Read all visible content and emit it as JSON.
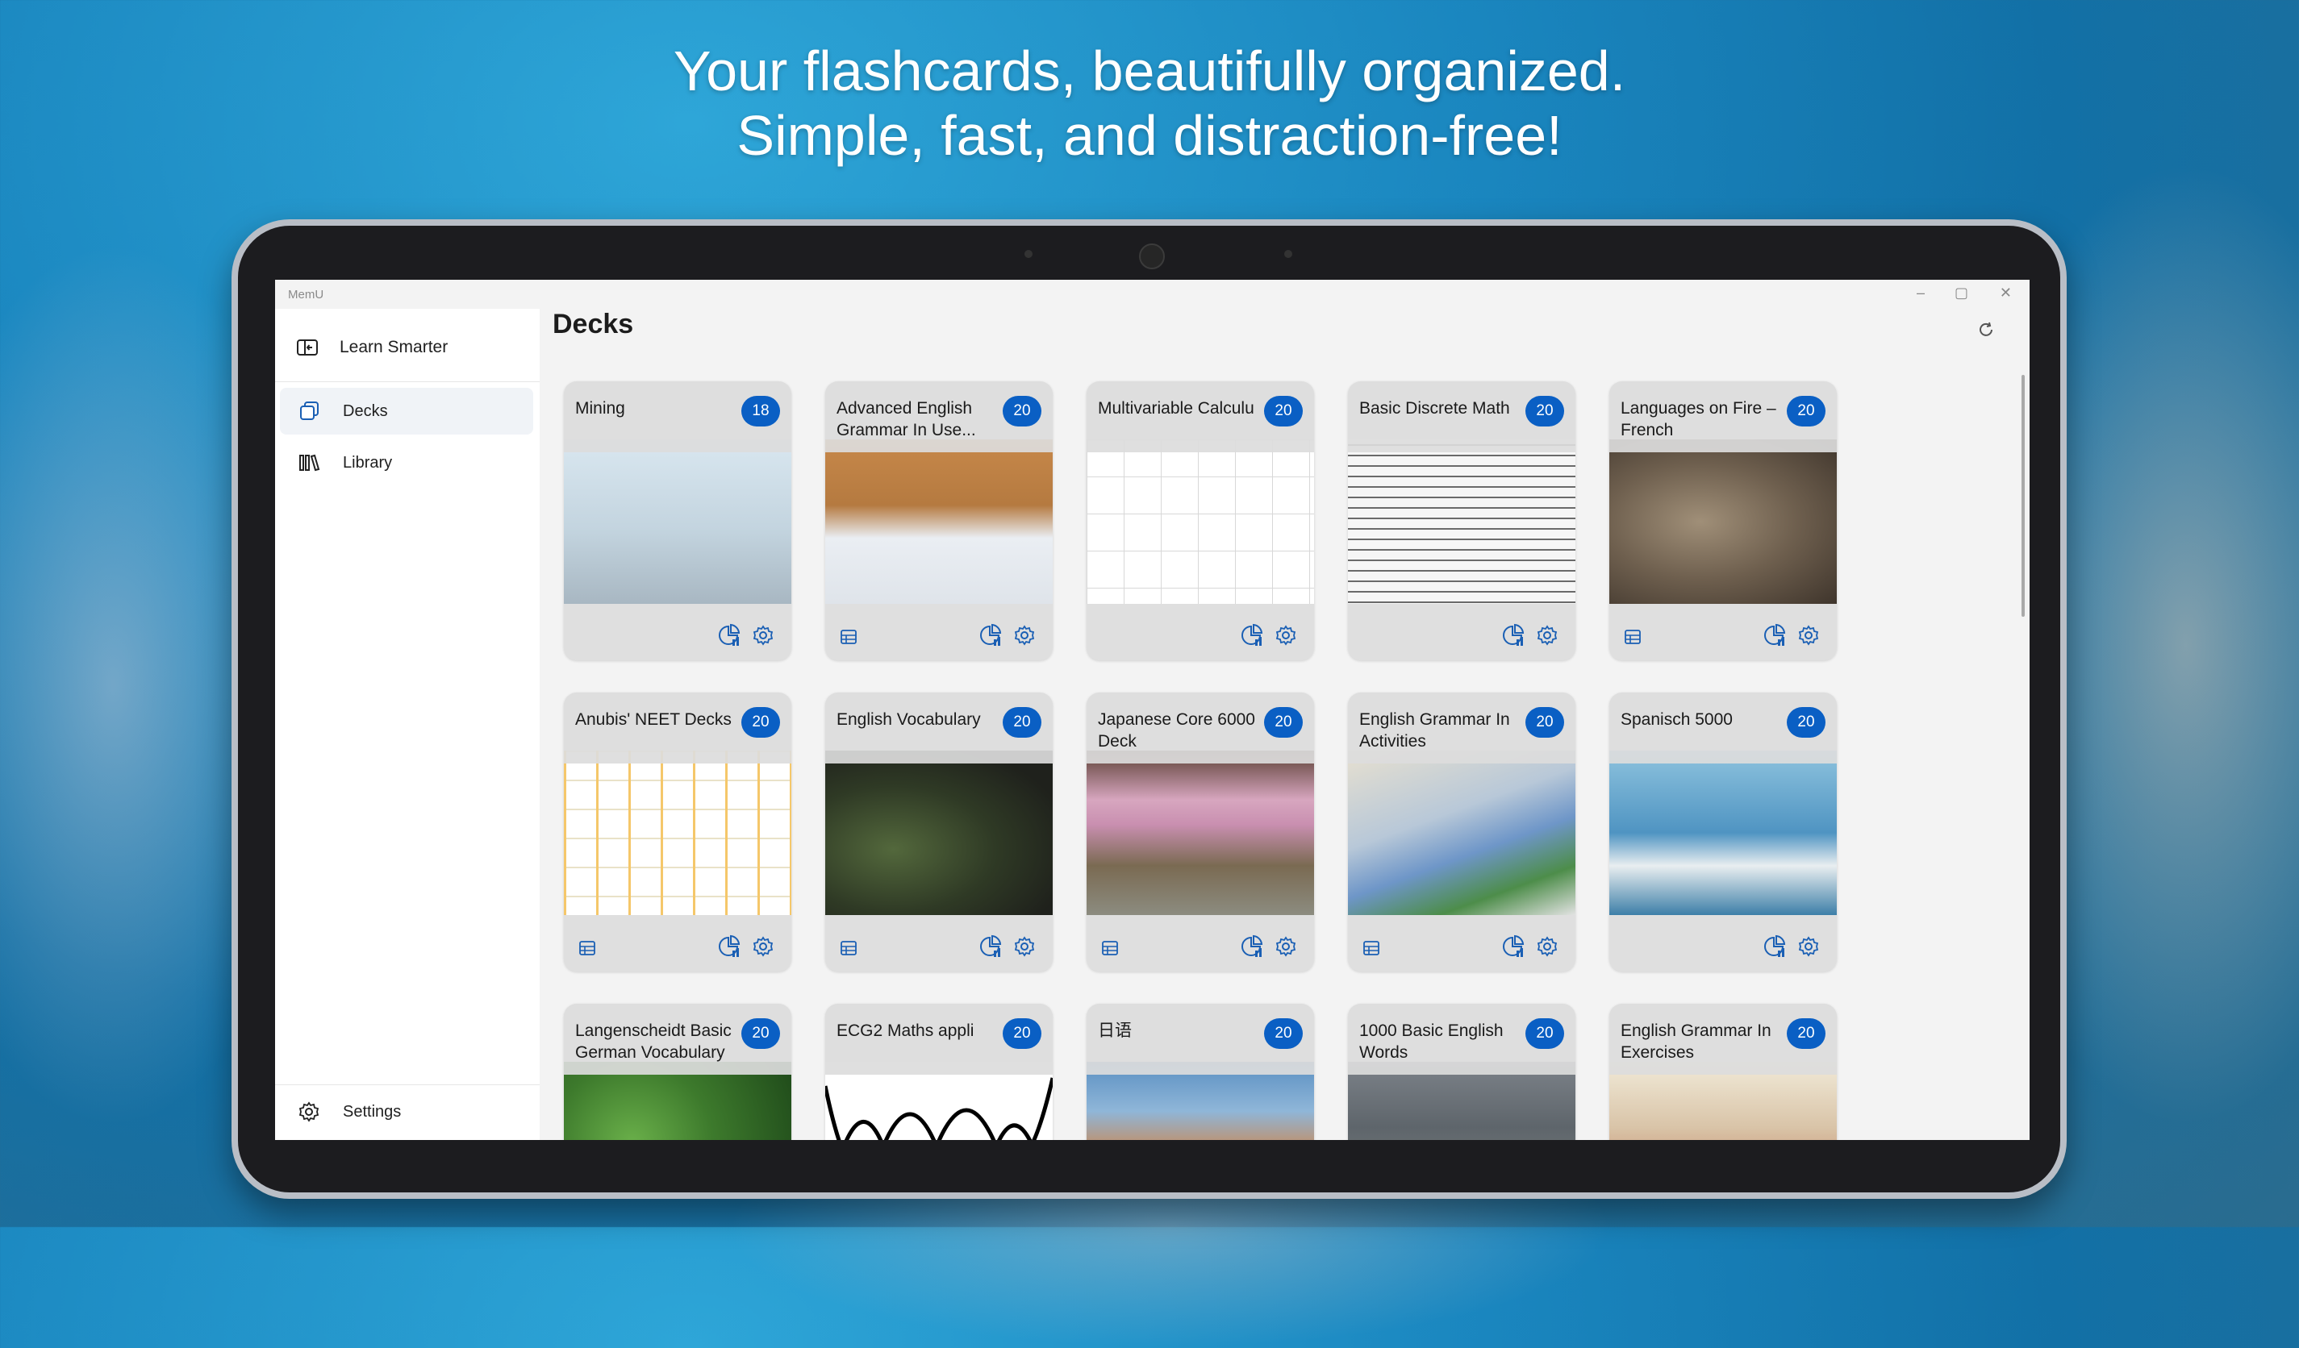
{
  "headline": {
    "line1": "Your flashcards, beautifully organized.",
    "line2": "Simple, fast, and distraction-free!"
  },
  "window": {
    "app_name": "MemU",
    "minimize_icon": "minimize-icon",
    "maximize_icon": "maximize-icon",
    "close_icon": "close-icon"
  },
  "sidebar": {
    "header_label": "Learn Smarter",
    "items": [
      {
        "label": "Decks",
        "icon": "decks-icon",
        "active": true
      },
      {
        "label": "Library",
        "icon": "library-icon",
        "active": false
      }
    ],
    "footer": {
      "label": "Settings",
      "icon": "gear-icon"
    }
  },
  "main": {
    "title": "Decks",
    "refresh_icon": "refresh-icon"
  },
  "colors": {
    "badge": "#0a5fc4",
    "icon_blue": "#1a5fb4",
    "background": "#1a86bf"
  },
  "decks": [
    {
      "title": "Mining",
      "count": "18",
      "has_table_icon": false
    },
    {
      "title": "Advanced English Grammar In Use...",
      "count": "20",
      "has_table_icon": true
    },
    {
      "title": "Multivariable Calculu",
      "count": "20",
      "has_table_icon": false
    },
    {
      "title": "Basic Discrete Math",
      "count": "20",
      "has_table_icon": false
    },
    {
      "title": "Languages on Fire – French",
      "count": "20",
      "has_table_icon": true
    },
    {
      "title": "Anubis' NEET Decks",
      "count": "20",
      "has_table_icon": true
    },
    {
      "title": "English Vocabulary",
      "count": "20",
      "has_table_icon": true
    },
    {
      "title": "Japanese Core 6000 Deck",
      "count": "20",
      "has_table_icon": true
    },
    {
      "title": "English Grammar In Activities",
      "count": "20",
      "has_table_icon": true
    },
    {
      "title": "Spanisch 5000",
      "count": "20",
      "has_table_icon": false
    },
    {
      "title": "Langenscheidt Basic German Vocabulary",
      "count": "20",
      "has_table_icon": false
    },
    {
      "title": "ECG2 Maths appli",
      "count": "20",
      "has_table_icon": false
    },
    {
      "title": "日语",
      "count": "20",
      "has_table_icon": false
    },
    {
      "title": "1000 Basic English Words",
      "count": "20",
      "has_table_icon": false
    },
    {
      "title": "English Grammar In Exercises",
      "count": "20",
      "has_table_icon": false
    }
  ]
}
